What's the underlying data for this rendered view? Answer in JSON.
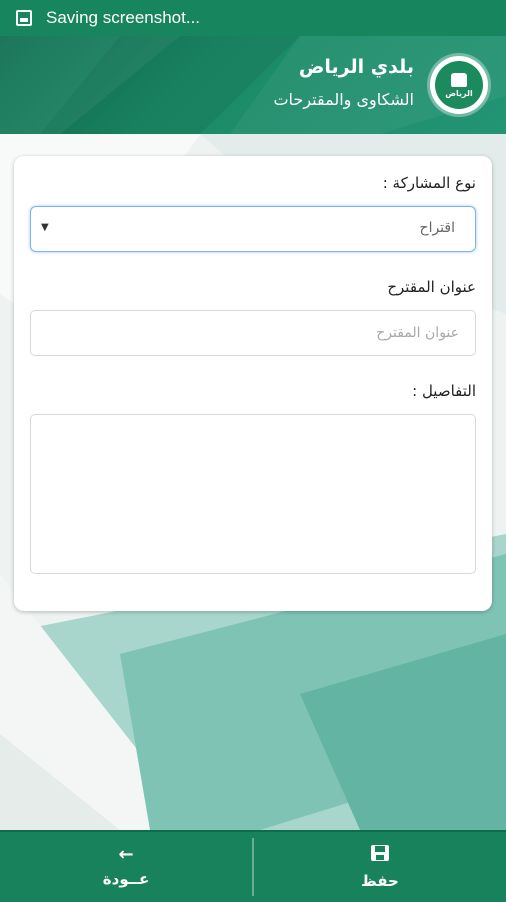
{
  "status_bar": {
    "text": "Saving screenshot...",
    "icon": "screenshot-icon"
  },
  "header": {
    "title": "بلدي الرياض",
    "subtitle": "الشكاوى والمقترحات",
    "logo_text": "الرياض",
    "color": "#17865f"
  },
  "form": {
    "type_label": "نوع المشاركة :",
    "type_value": "اقتراح",
    "title_label": "عنوان المقترح",
    "title_placeholder": "عنوان المقترح",
    "details_label": "التفاصيل :"
  },
  "bottom_bar": {
    "back_label": "عــودة",
    "back_icon": "arrow-left-icon",
    "save_label": "حفظ",
    "save_icon": "save-icon"
  }
}
